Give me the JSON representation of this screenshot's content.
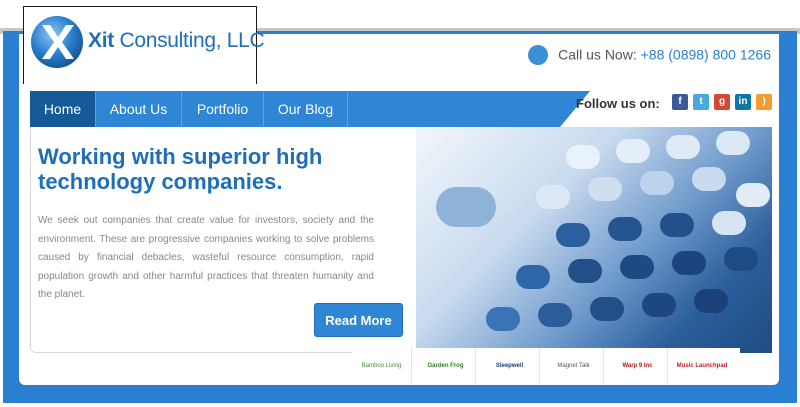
{
  "brand": {
    "name_bold": "Xit",
    "name_rest": " Consulting, LLC"
  },
  "contact": {
    "label": "Call us Now: ",
    "phone": "+88 (0898) 800 1266"
  },
  "nav": {
    "items": [
      "Home",
      "About Us",
      "Portfolio",
      "Our Blog"
    ]
  },
  "social": {
    "label": "Follow us on:",
    "networks": [
      "facebook",
      "twitter",
      "google-plus",
      "linkedin",
      "rss"
    ]
  },
  "hero": {
    "headline": "Working with superior high technology companies.",
    "description": "We seek out companies that create value for investors, society and the environment. These are progressive companies working to solve problems caused by financial debacles, wasteful resource consumption, rapid population growth and other harmful practices that threaten humanity and the planet.",
    "button": "Read More"
  },
  "partners": {
    "logos": [
      "Bamboo Living",
      "Garden Frog",
      "Sleepwell",
      "Magnet Talk",
      "Warp 9 Inc",
      "Music Launchpad"
    ]
  },
  "colors": {
    "primary": "#2e86d4",
    "dark": "#155a97",
    "heading": "#1f6fb8"
  }
}
